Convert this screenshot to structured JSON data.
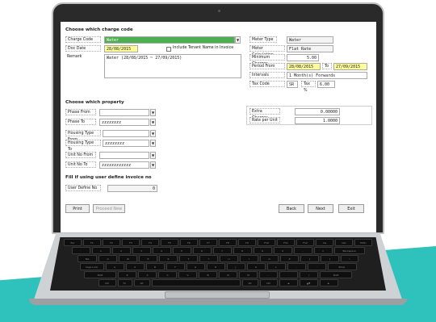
{
  "charge": {
    "section": "Choose which charge code",
    "code_label": "Charge Code",
    "code_value": "Water",
    "date_label": "Doc Date",
    "date_value": "28/08/2015",
    "include_tenant_label": "Include Tenant Name in Invoice",
    "remark_label": "Remark",
    "remark_value": "Water (28/08/2015 ~ 27/09/2015)"
  },
  "meter": {
    "type_label": "Meter Type",
    "type_value": "Water",
    "calc_label": "Meter Calculation",
    "calc_value": "Flat Rate",
    "min_label": "Minimum Charges",
    "min_value": "5.00",
    "period_label": "Period From",
    "period_from": "28/08/2015",
    "to_label": "To",
    "period_to": "27/09/2015",
    "intervals_label": "Intervals",
    "intervals_value": "1 Month(s) Forwards",
    "tax_label": "Tax Code",
    "tax_code": "SR",
    "tax_pct_label": "Tax %",
    "tax_pct": "6.00",
    "extra_label": "Extra Charges",
    "extra_value": "0.00000",
    "rate_label": "Rate per Unit",
    "rate_value": "1.0000"
  },
  "property": {
    "section": "Choose which property",
    "phase_from_label": "Phase From",
    "phase_from_value": "",
    "phase_to_label": "Phase To",
    "phase_to_value": "zzzzzzzz",
    "housing_from_label": "Housing Type From",
    "housing_from_value": "",
    "housing_to_label": "Housing Type To",
    "housing_to_value": "zzzzzzzz",
    "unit_from_label": "Unit No From",
    "unit_from_value": "",
    "unit_to_label": "Unit No To",
    "unit_to_value": "zzzzzzzzzzzz"
  },
  "invoice": {
    "section": "Fill if using user define invoice no",
    "user_define_label": "User Define No",
    "user_define_value": "0"
  },
  "buttons": {
    "print": "Print",
    "proceed_new": "Proceed New",
    "back": "Back",
    "next": "Next",
    "exit": "Exit"
  },
  "keyboard": {
    "row1": [
      "Esc",
      "F1",
      "F2",
      "F3",
      "F4",
      "F5",
      "F6",
      "F7",
      "F8",
      "F9",
      "F10",
      "F11",
      "F12",
      "Ins",
      "Del",
      "PrtSc"
    ],
    "row2": [
      "`",
      "1",
      "2",
      "3",
      "4",
      "5",
      "6",
      "7",
      "8",
      "9",
      "0",
      "-",
      "=",
      "Backspace"
    ],
    "row3": [
      "Tab",
      "Q",
      "W",
      "E",
      "R",
      "T",
      "Y",
      "U",
      "I",
      "O",
      "P",
      "[",
      "]",
      "\\"
    ],
    "row4": [
      "Caps Lock",
      "A",
      "S",
      "D",
      "F",
      "G",
      "H",
      "J",
      "K",
      "L",
      ";",
      "'",
      "Enter"
    ],
    "row5": [
      "Shift",
      "Z",
      "X",
      "C",
      "V",
      "B",
      "N",
      "M",
      ",",
      ".",
      "/",
      "Shift"
    ],
    "row6": [
      "Ctrl",
      "Fn",
      "Alt",
      "",
      "Alt",
      "Ctrl",
      "◄",
      "▲▼",
      "►"
    ]
  },
  "colors": {
    "teal": "#2fc2bc",
    "highlight": "#ffff99",
    "selected": "#4caf50"
  }
}
